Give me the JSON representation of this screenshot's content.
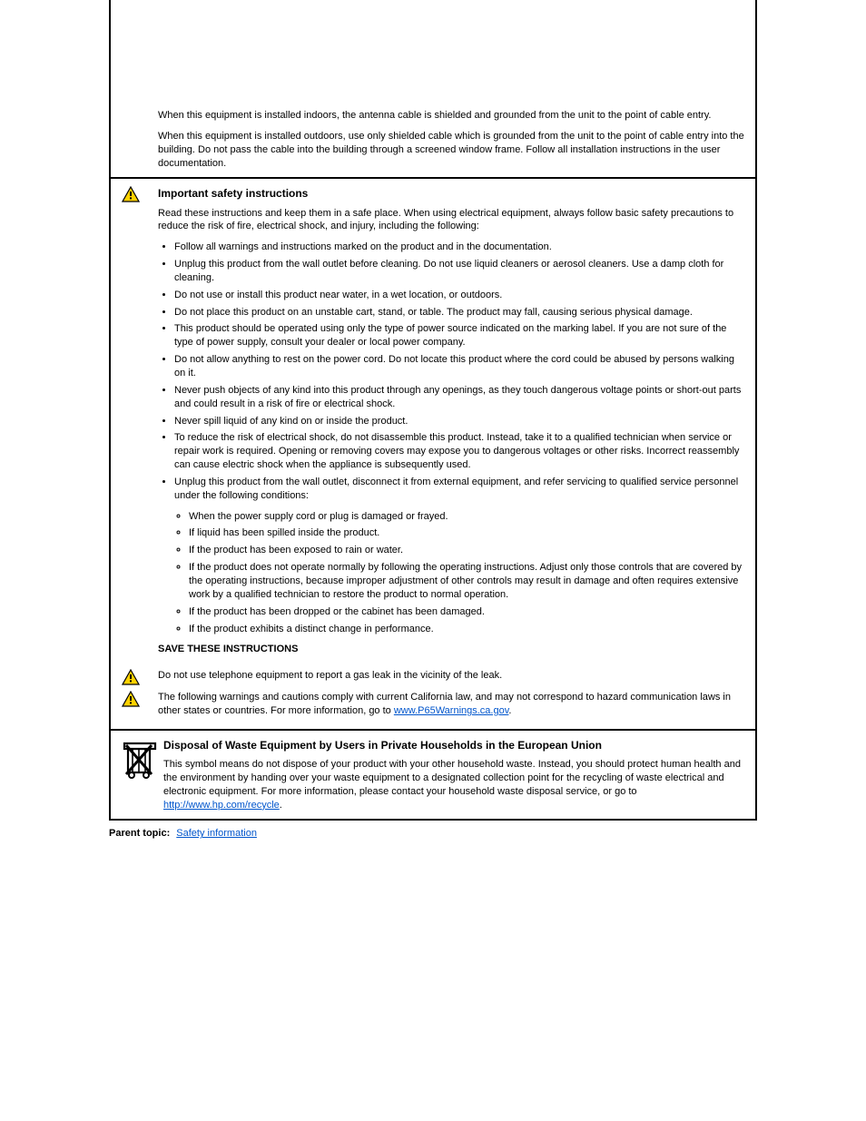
{
  "cell1": {
    "p1": "When this equipment is installed indoors, the antenna cable is shielded and grounded from the unit to the point of cable entry.",
    "p2": "When this equipment is installed outdoors, use only shielded cable which is grounded from the unit to the point of cable entry into the building. Do not pass the cable into the building through a screened window frame. Follow all installation instructions in the user documentation."
  },
  "cell2": {
    "heading": "Important safety instructions",
    "intro": "Read these instructions and keep them in a safe place. When using electrical equipment, always follow basic safety precautions to reduce the risk of fire, electrical shock, and injury, including the following:",
    "items": [
      "Follow all warnings and instructions marked on the product and in the documentation.",
      "Unplug this product from the wall outlet before cleaning. Do not use liquid cleaners or aerosol cleaners. Use a damp cloth for cleaning.",
      "Do not use or install this product near water, in a wet location, or outdoors.",
      "Do not place this product on an unstable cart, stand, or table. The product may fall, causing serious physical damage.",
      "This product should be operated using only the type of power source indicated on the marking label. If you are not sure of the type of power supply, consult your dealer or local power company.",
      "Do not allow anything to rest on the power cord. Do not locate this product where the cord could be abused by persons walking on it.",
      "Never push objects of any kind into this product through any openings, as they touch dangerous voltage points or short-out parts and could result in a risk of fire or electrical shock.",
      "Never spill liquid of any kind on or inside the product.",
      "To reduce the risk of electrical shock, do not disassemble this product. Instead, take it to a qualified technician when service or repair work is required. Opening or removing covers may expose you to dangerous voltages or other risks. Incorrect reassembly can cause electric shock when the appliance is subsequently used.",
      "Unplug this product from the wall outlet, disconnect it from external equipment, and refer servicing to qualified service personnel under the following conditions:"
    ],
    "subitems": [
      "When the power supply cord or plug is damaged or frayed.",
      "If liquid has been spilled inside the product.",
      "If the product has been exposed to rain or water.",
      "If the product does not operate normally by following the operating instructions. Adjust only those controls that are covered by the operating instructions, because improper adjustment of other controls may result in damage and often requires extensive work by a qualified technician to restore the product to normal operation.",
      "If the product has been dropped or the cabinet has been damaged.",
      "If the product exhibits a distinct change in performance."
    ],
    "closing": "SAVE THESE INSTRUCTIONS",
    "w2": "Do not use telephone equipment to report a gas leak in the vicinity of the leak.",
    "w3_before": "",
    "w3_text": "The following warnings and cautions comply with current California law, and may not correspond to hazard communication laws in other states or countries. For more information, go to ",
    "w3_link": "www.P65Warnings.ca.gov",
    "w3_after": "."
  },
  "cell3": {
    "heading": "Disposal of Waste Equipment by Users in Private Households in the European Union",
    "body_before": "This symbol means do not dispose of your product with your other household waste. Instead, you should protect human health and the environment by handing over your waste equipment to a designated collection point for the recycling of waste electrical and electronic equipment. For more information, please contact your household waste disposal service, or go to ",
    "body_link": "http://www.hp.com/recycle",
    "body_after": "."
  },
  "footer": {
    "link": "Parent topic:",
    "link_text": "Safety information",
    "line2": ""
  }
}
